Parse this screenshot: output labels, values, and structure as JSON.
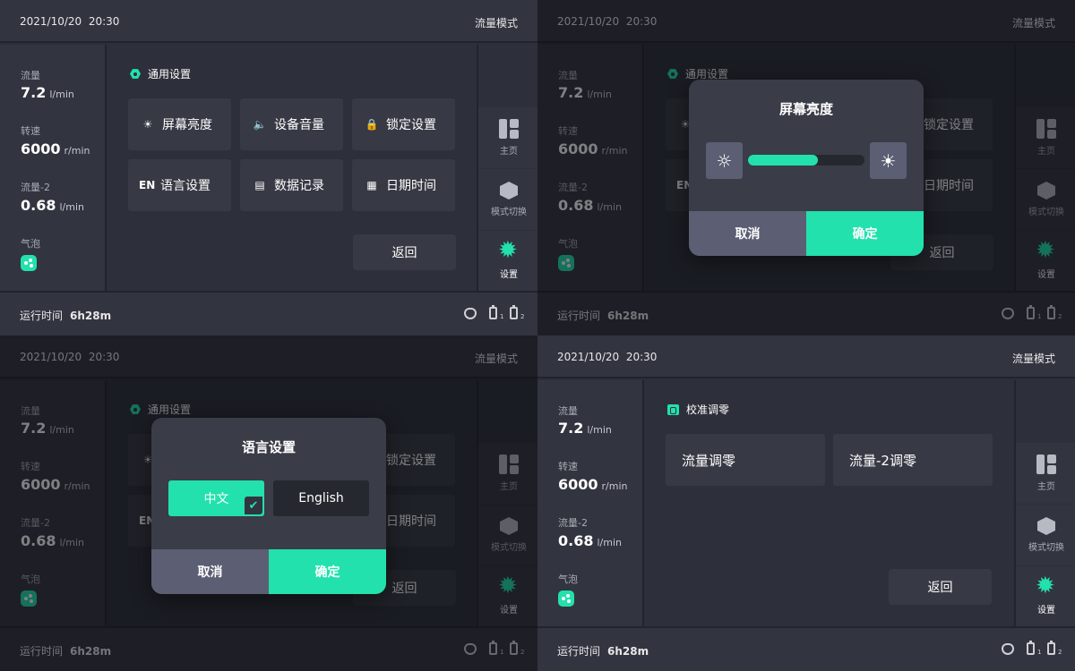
{
  "topbar": {
    "date": "2021/10/20",
    "time": "20:30",
    "mode": "流量模式"
  },
  "metrics": {
    "flow": {
      "label": "流量",
      "value": "7.2",
      "unit": "l/min"
    },
    "speed": {
      "label": "转速",
      "value": "6000",
      "unit": "r/min"
    },
    "flow2": {
      "label": "流量-2",
      "value": "0.68",
      "unit": "l/min"
    },
    "bubble": {
      "label": "气泡"
    }
  },
  "general": {
    "title": "通用设置",
    "tiles": [
      {
        "icon": "☀",
        "label": "屏幕亮度"
      },
      {
        "icon": "🔈",
        "label": "设备音量"
      },
      {
        "icon": "🔒",
        "label": "锁定设置"
      },
      {
        "icon": "EN",
        "label": "语言设置"
      },
      {
        "icon": "▤",
        "label": "数据记录"
      },
      {
        "icon": "▦",
        "label": "日期时间"
      }
    ],
    "back": "返回"
  },
  "nav": {
    "home": "主页",
    "switch": "模式切换",
    "settings": "设置"
  },
  "bottombar": {
    "runtime_label": "运行时间",
    "runtime_value": "6h28m",
    "bat1": "1",
    "bat2": "2"
  },
  "brightness_dialog": {
    "title": "屏幕亮度",
    "level": 0.6,
    "cancel": "取消",
    "ok": "确定"
  },
  "language_dialog": {
    "title": "语言设置",
    "options": [
      "中文",
      "English"
    ],
    "selected": 0,
    "cancel": "取消",
    "ok": "确定"
  },
  "calibration": {
    "title": "校准调零",
    "tiles": [
      "流量调零",
      "流量-2调零"
    ],
    "back": "返回"
  },
  "colors": {
    "accent": "#22e1ac",
    "panel": "#2d2f3a",
    "bar": "#32343f",
    "tile": "#373944"
  }
}
